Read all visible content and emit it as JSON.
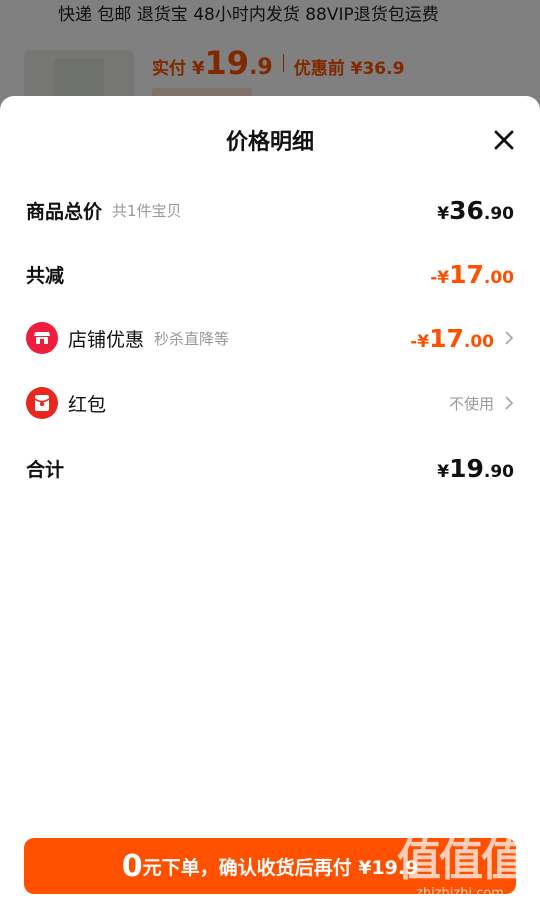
{
  "background": {
    "topline": "快递 包邮 退货宝 48小时内发货 88VIP退货包运费",
    "pay_label": "实付",
    "yen": "¥",
    "pay_int": "19",
    "pay_dec": ".9",
    "orig_label": "优惠前 ¥36.9"
  },
  "sheet": {
    "title": "价格明细",
    "rows": [
      {
        "label": "商品总价",
        "sub": "共1件宝贝",
        "yen": "¥",
        "int": "36",
        "dec": ".90"
      },
      {
        "label": "共减",
        "yen": "-¥",
        "int": "17",
        "dec": ".00"
      },
      {
        "label": "店铺优惠",
        "sub": "秒杀直降等",
        "yen": "-¥",
        "int": "17",
        "dec": ".00"
      },
      {
        "label": "红包",
        "value": "不使用"
      },
      {
        "label": "合计",
        "yen": "¥",
        "int": "19",
        "dec": ".90"
      }
    ],
    "cta": {
      "num": "0",
      "text": "元下单，确认收货后再付 ¥19.9"
    }
  },
  "watermark": {
    "big": "值值值",
    "small": "zhizhizhi.com"
  },
  "colors": {
    "accent": "#ff5000",
    "store_icon": "#ee1d3c",
    "redpacket_icon": "#e8281f"
  }
}
